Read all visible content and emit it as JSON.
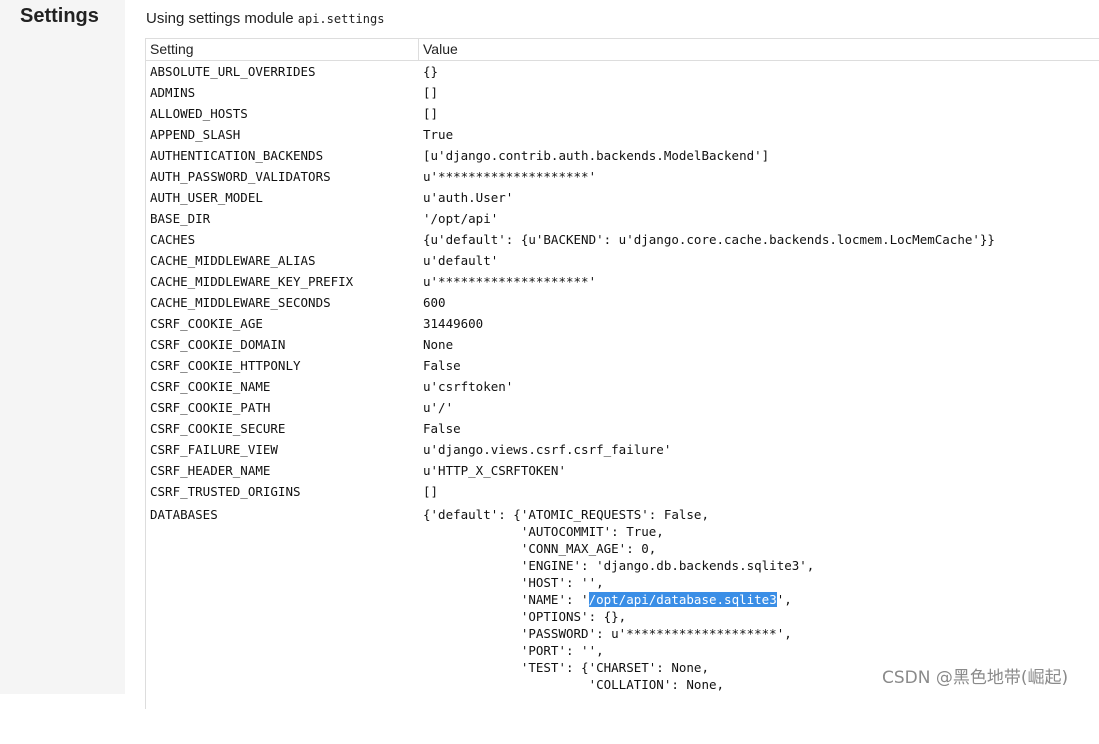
{
  "sidebar": {
    "title": "Settings"
  },
  "heading": {
    "text": "Using settings module",
    "module": "api.settings"
  },
  "table": {
    "headers": {
      "setting": "Setting",
      "value": "Value"
    },
    "rows": [
      {
        "key": "ABSOLUTE_URL_OVERRIDES",
        "value": "{}"
      },
      {
        "key": "ADMINS",
        "value": "[]"
      },
      {
        "key": "ALLOWED_HOSTS",
        "value": "[]"
      },
      {
        "key": "APPEND_SLASH",
        "value": "True"
      },
      {
        "key": "AUTHENTICATION_BACKENDS",
        "value": "[u'django.contrib.auth.backends.ModelBackend']"
      },
      {
        "key": "AUTH_PASSWORD_VALIDATORS",
        "value": "u'********************'"
      },
      {
        "key": "AUTH_USER_MODEL",
        "value": "u'auth.User'"
      },
      {
        "key": "BASE_DIR",
        "value": "'/opt/api'"
      },
      {
        "key": "CACHES",
        "value": "{u'default': {u'BACKEND': u'django.core.cache.backends.locmem.LocMemCache'}}"
      },
      {
        "key": "CACHE_MIDDLEWARE_ALIAS",
        "value": "u'default'"
      },
      {
        "key": "CACHE_MIDDLEWARE_KEY_PREFIX",
        "value": "u'********************'"
      },
      {
        "key": "CACHE_MIDDLEWARE_SECONDS",
        "value": "600"
      },
      {
        "key": "CSRF_COOKIE_AGE",
        "value": "31449600"
      },
      {
        "key": "CSRF_COOKIE_DOMAIN",
        "value": "None"
      },
      {
        "key": "CSRF_COOKIE_HTTPONLY",
        "value": "False"
      },
      {
        "key": "CSRF_COOKIE_NAME",
        "value": "u'csrftoken'"
      },
      {
        "key": "CSRF_COOKIE_PATH",
        "value": "u'/'"
      },
      {
        "key": "CSRF_COOKIE_SECURE",
        "value": "False"
      },
      {
        "key": "CSRF_FAILURE_VIEW",
        "value": "u'django.views.csrf.csrf_failure'"
      },
      {
        "key": "CSRF_HEADER_NAME",
        "value": "u'HTTP_X_CSRFTOKEN'"
      },
      {
        "key": "CSRF_TRUSTED_ORIGINS",
        "value": "[]"
      }
    ],
    "databases": {
      "key": "DATABASES",
      "lines": [
        "{'default': {'ATOMIC_REQUESTS': False,",
        "             'AUTOCOMMIT': True,",
        "             'CONN_MAX_AGE': 0,",
        "             'ENGINE': 'django.db.backends.sqlite3',",
        "             'HOST': '',",
        "             'NAME': '",
        "             'OPTIONS': {},",
        "             'PASSWORD': u'********************',",
        "             'PORT': '',",
        "             'TEST': {'CHARSET': None,",
        "                      'COLLATION': None,"
      ],
      "name_selected": "/opt/api/database.sqlite3",
      "name_after": "',"
    }
  },
  "watermark": "CSDN @黑色地带(崛起)"
}
